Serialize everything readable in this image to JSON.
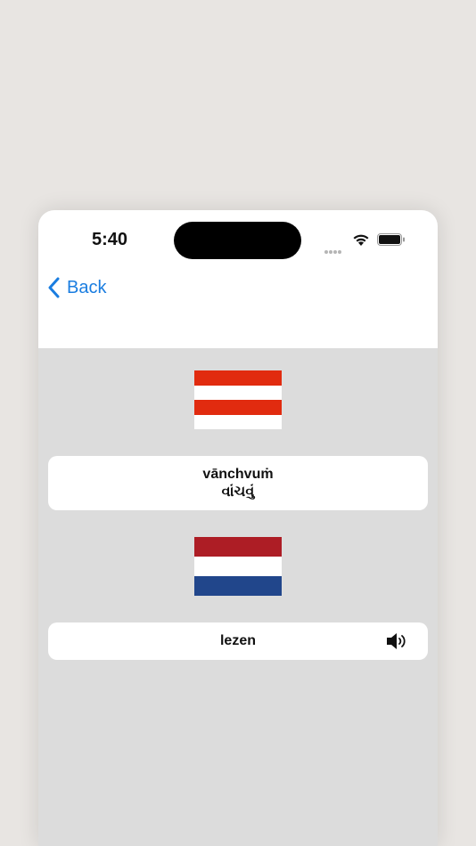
{
  "status_bar": {
    "time": "5:40"
  },
  "nav": {
    "back_label": "Back"
  },
  "colors": {
    "accent": "#1a7de0",
    "austria_red": "#e12b0f",
    "netherlands_red": "#ad1d25",
    "netherlands_blue": "#21468b",
    "panel_bg": "#dcdcdc"
  },
  "flags": [
    {
      "country": "Austria",
      "icon": "austria-flag-icon"
    },
    {
      "country": "Netherlands",
      "icon": "netherlands-flag-icon"
    }
  ],
  "source_word": {
    "transliteration": "vānchvuṁ",
    "native": "વાંચવું"
  },
  "target_word": {
    "text": "lezen",
    "speaker_icon": "speaker-icon"
  }
}
